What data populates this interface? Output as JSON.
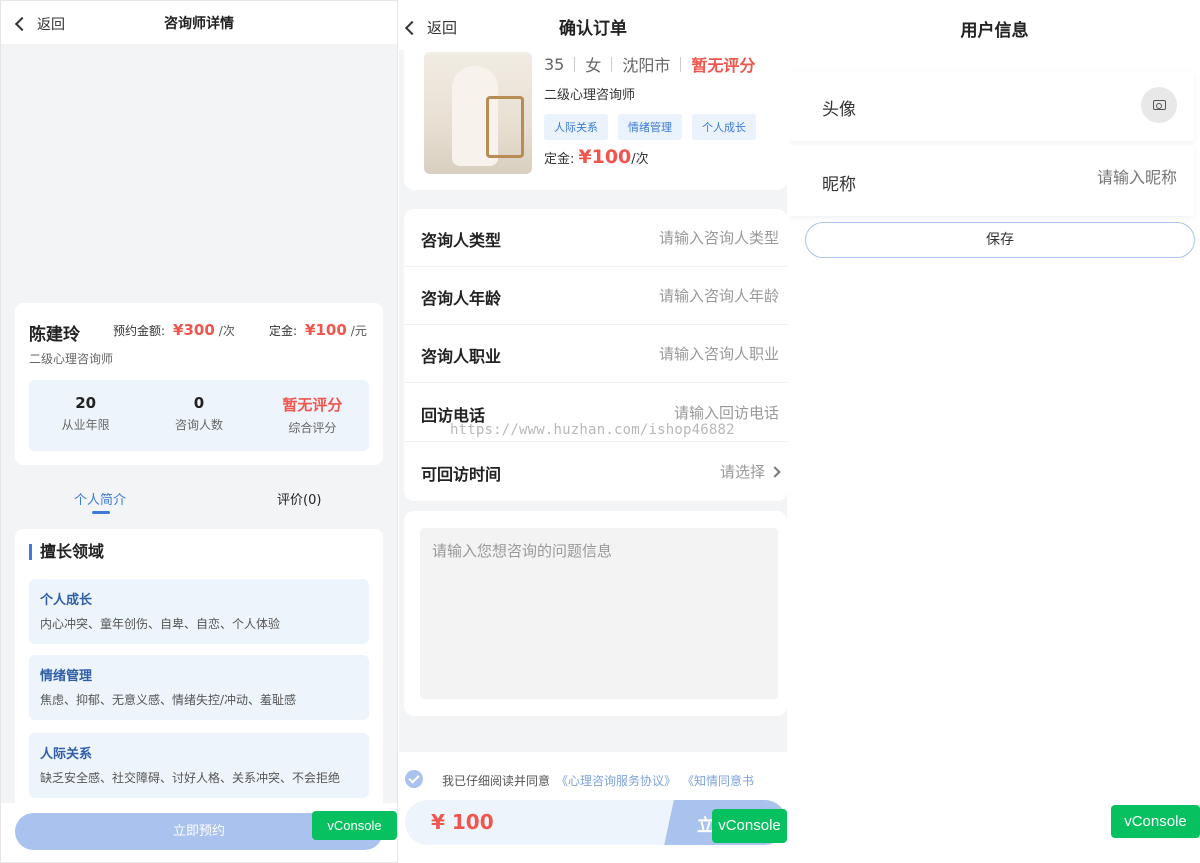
{
  "watermark": "https://www.huzhan.com/ishop46882",
  "vconsole_label": "vConsole",
  "screen1": {
    "back_label": "返回",
    "title": "咨询师详情",
    "counselor": {
      "name": "陈建玲",
      "booking_label": "预约金额:",
      "booking_price": "¥300",
      "booking_unit": "/次",
      "deposit_label": "定金:",
      "deposit_price": "¥100",
      "deposit_unit": "/元",
      "level": "二级心理咨询师"
    },
    "stats": [
      {
        "value": "20",
        "label": "从业年限"
      },
      {
        "value": "0",
        "label": "咨询人数"
      },
      {
        "value": "暂无评分",
        "label": "综合评分"
      }
    ],
    "tabs": [
      {
        "label": "个人简介",
        "active": true
      },
      {
        "label": "评价(0)",
        "active": false
      }
    ],
    "specialty_title": "擅长领域",
    "specialties": [
      {
        "title": "个人成长",
        "desc": "内心冲突、童年创伤、自卑、自恋、个人体验"
      },
      {
        "title": "情绪管理",
        "desc": "焦虑、抑郁、无意义感、情绪失控/冲动、羞耻感"
      },
      {
        "title": "人际关系",
        "desc": "缺乏安全感、社交障碍、讨好人格、关系冲突、不会拒绝"
      }
    ],
    "book_button": "立即预约"
  },
  "screen2": {
    "back_label": "返回",
    "title": "确认订单",
    "counselor": {
      "age": "35",
      "gender": "女",
      "city": "沈阳市",
      "rating": "暂无评分",
      "level": "二级心理咨询师",
      "tags": [
        "人际关系",
        "情绪管理",
        "个人成长"
      ],
      "deposit_label": "定金:",
      "deposit_price": "¥100",
      "deposit_unit": "/次"
    },
    "form": [
      {
        "label": "咨询人类型",
        "placeholder": "请输入咨询人类型"
      },
      {
        "label": "咨询人年龄",
        "placeholder": "请输入咨询人年龄"
      },
      {
        "label": "咨询人职业",
        "placeholder": "请输入咨询人职业"
      },
      {
        "label": "回访电话",
        "placeholder": "请输入回访电话"
      },
      {
        "label": "可回访时间",
        "placeholder": "请选择"
      }
    ],
    "question_placeholder": "请输入您想咨询的问题信息",
    "agreement": {
      "prefix": "我已仔细阅读并同意",
      "link1": "《心理咨询服务协议》",
      "link2": "《知情同意书"
    },
    "total": "¥ 100",
    "submit_label": "立"
  },
  "screen3": {
    "title": "用户信息",
    "avatar_label": "头像",
    "nickname_label": "昵称",
    "nickname_placeholder": "请输入昵称",
    "save_button": "保存"
  },
  "colors": {
    "accent": "#3d7bd9",
    "price_red": "#f0564d",
    "button_blue": "#a9c2ee",
    "vconsole_green": "#07c160"
  },
  "icons": [
    "chevron-left-icon",
    "chevron-right-icon",
    "camera-icon",
    "check-icon"
  ]
}
